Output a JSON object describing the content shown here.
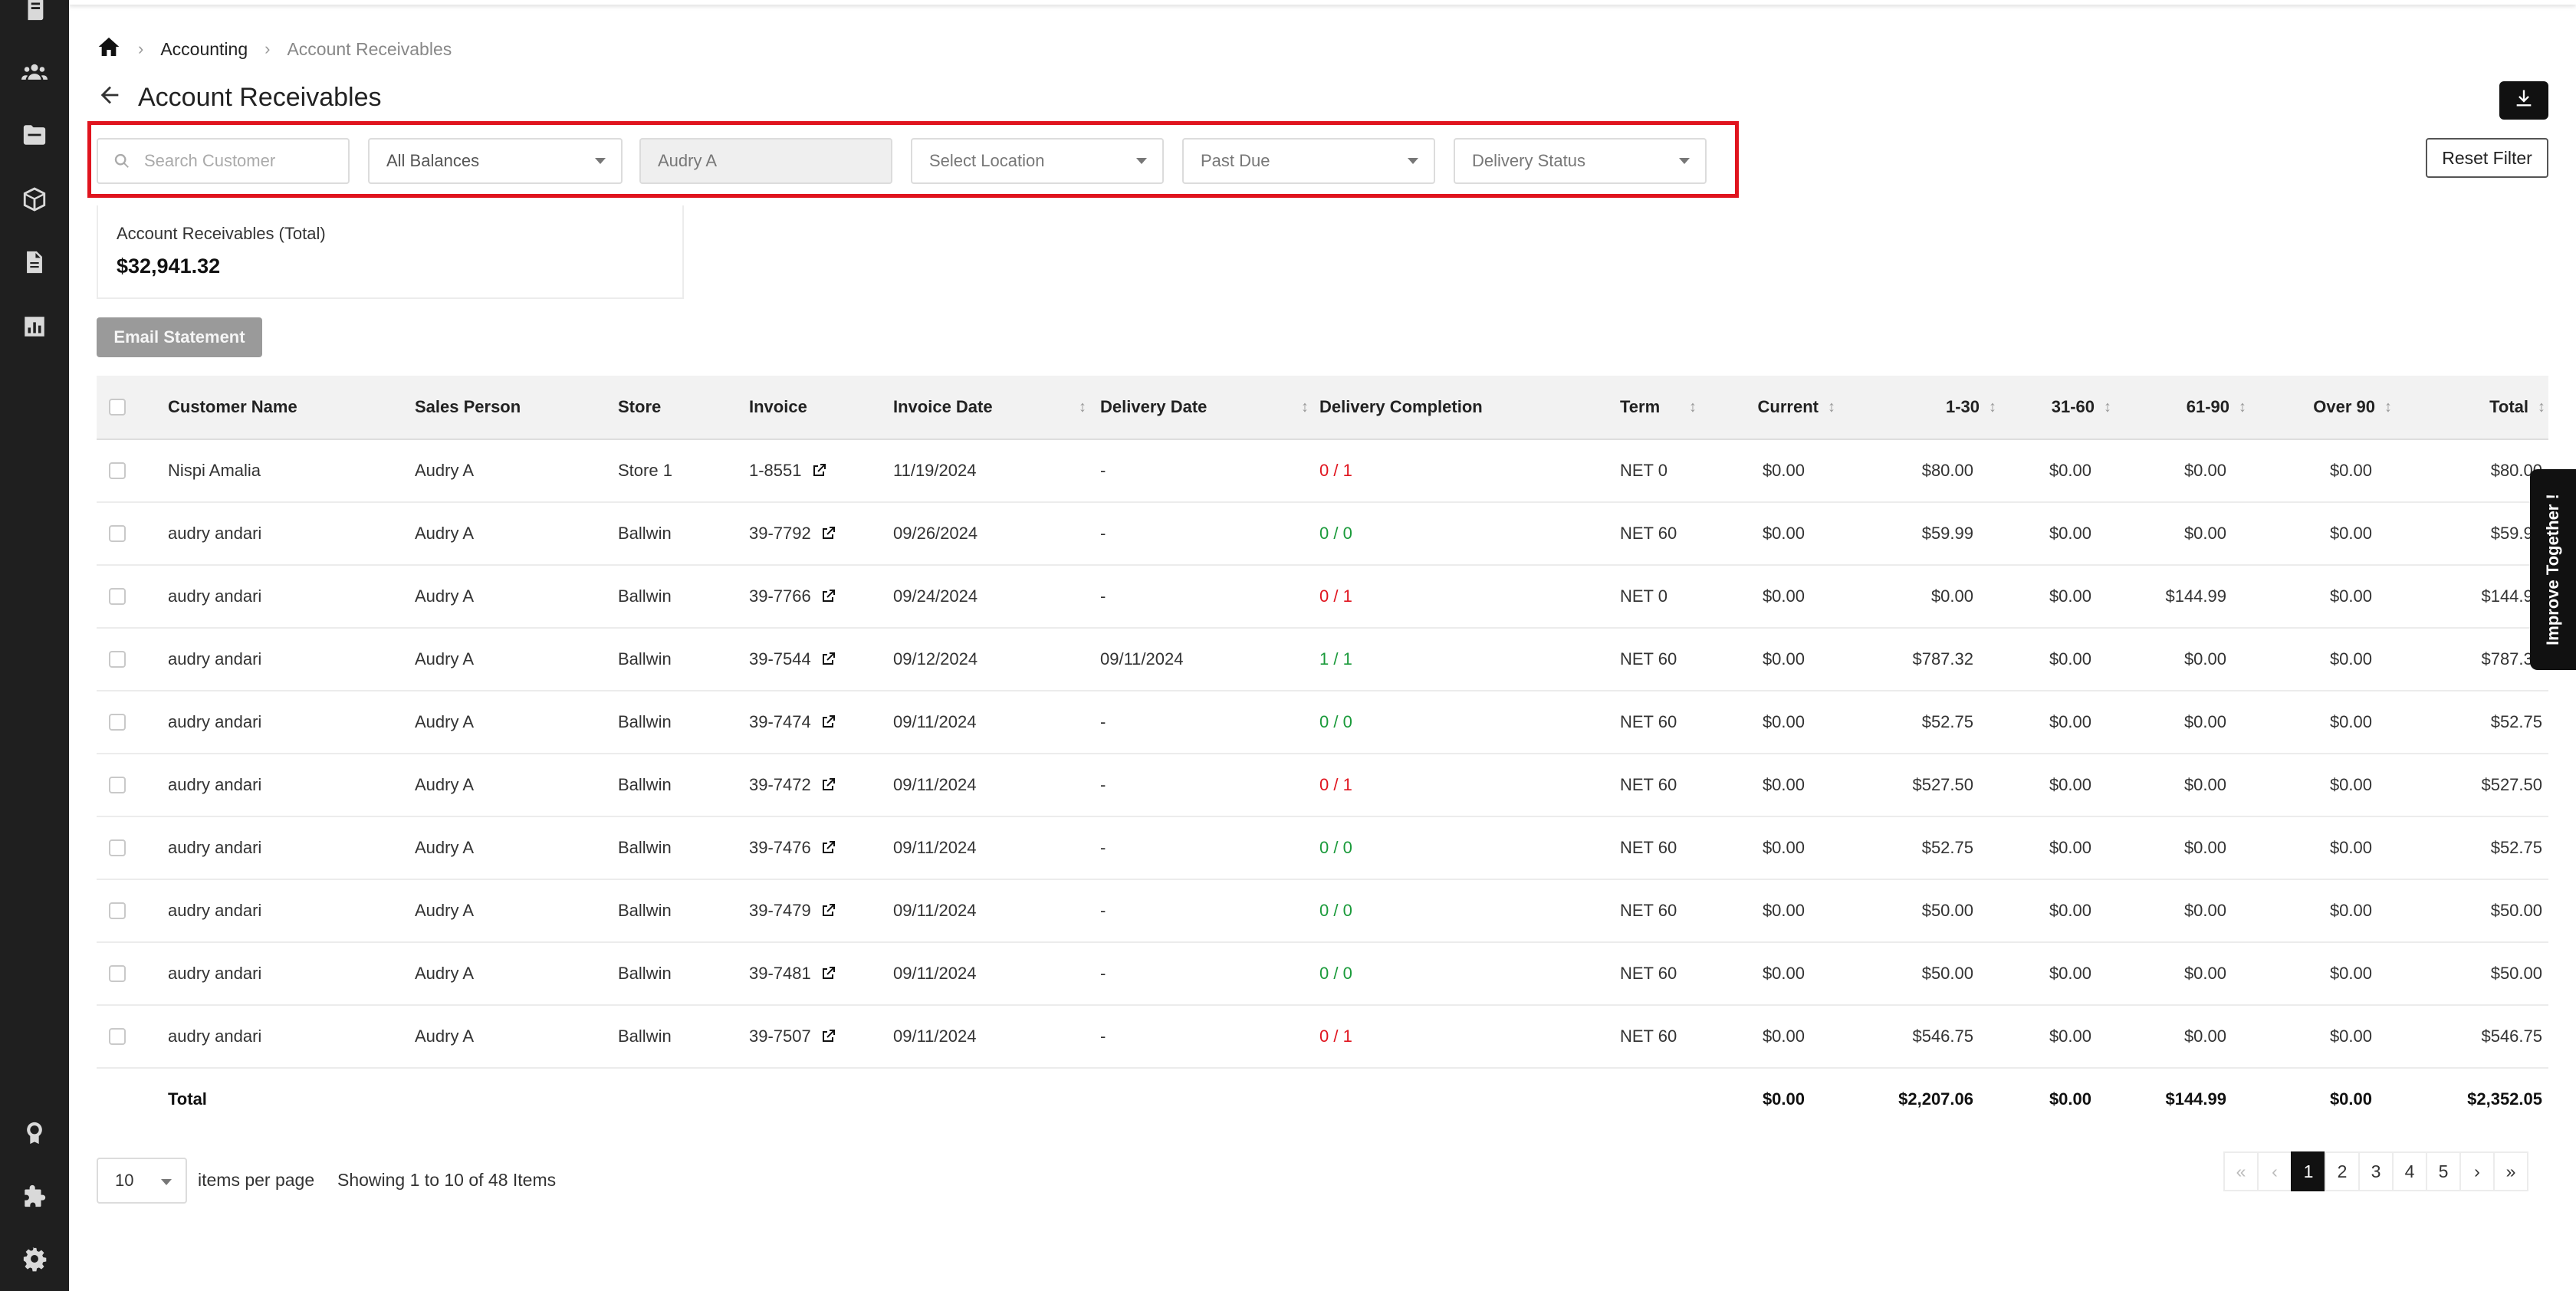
{
  "breadcrumb": {
    "parent": "Accounting",
    "current": "Account Receivables",
    "separator": "›"
  },
  "page": {
    "title": "Account Receivables"
  },
  "filters": {
    "search_placeholder": "Search Customer",
    "balances": "All Balances",
    "sales_person": "Audry A",
    "location": "Select Location",
    "past_due": "Past Due",
    "delivery_status": "Delivery Status",
    "reset_label": "Reset Filter"
  },
  "summary": {
    "label": "Account Receivables (Total)",
    "value": "$32,941.32"
  },
  "actions": {
    "email_statement": "Email Statement"
  },
  "table": {
    "headers": {
      "customer": "Customer Name",
      "sales_person": "Sales Person",
      "store": "Store",
      "invoice": "Invoice",
      "invoice_date": "Invoice Date",
      "delivery_date": "Delivery Date",
      "delivery_completion": "Delivery Completion",
      "term": "Term",
      "current": "Current",
      "d1_30": "1-30",
      "d31_60": "31-60",
      "d61_90": "61-90",
      "over90": "Over 90",
      "total": "Total"
    },
    "sort_glyph": "↕",
    "rows": [
      {
        "customer": "Nispi Amalia",
        "sales_person": "Audry A",
        "store": "Store 1",
        "invoice": "1-8551",
        "invoice_date": "11/19/2024",
        "delivery_date": "-",
        "delivery_completion": "0 / 1",
        "completion_status": "incomplete",
        "term": "NET 0",
        "current": "$0.00",
        "d1_30": "$80.00",
        "d31_60": "$0.00",
        "d61_90": "$0.00",
        "over90": "$0.00",
        "total": "$80.00"
      },
      {
        "customer": "audry andari",
        "sales_person": "Audry A",
        "store": "Ballwin",
        "invoice": "39-7792",
        "invoice_date": "09/26/2024",
        "delivery_date": "-",
        "delivery_completion": "0 / 0",
        "completion_status": "complete",
        "term": "NET 60",
        "current": "$0.00",
        "d1_30": "$59.99",
        "d31_60": "$0.00",
        "d61_90": "$0.00",
        "over90": "$0.00",
        "total": "$59.99"
      },
      {
        "customer": "audry andari",
        "sales_person": "Audry A",
        "store": "Ballwin",
        "invoice": "39-7766",
        "invoice_date": "09/24/2024",
        "delivery_date": "-",
        "delivery_completion": "0 / 1",
        "completion_status": "incomplete",
        "term": "NET 0",
        "current": "$0.00",
        "d1_30": "$0.00",
        "d31_60": "$0.00",
        "d61_90": "$144.99",
        "over90": "$0.00",
        "total": "$144.99"
      },
      {
        "customer": "audry andari",
        "sales_person": "Audry A",
        "store": "Ballwin",
        "invoice": "39-7544",
        "invoice_date": "09/12/2024",
        "delivery_date": "09/11/2024",
        "delivery_completion": "1 / 1",
        "completion_status": "complete",
        "term": "NET 60",
        "current": "$0.00",
        "d1_30": "$787.32",
        "d31_60": "$0.00",
        "d61_90": "$0.00",
        "over90": "$0.00",
        "total": "$787.32"
      },
      {
        "customer": "audry andari",
        "sales_person": "Audry A",
        "store": "Ballwin",
        "invoice": "39-7474",
        "invoice_date": "09/11/2024",
        "delivery_date": "-",
        "delivery_completion": "0 / 0",
        "completion_status": "complete",
        "term": "NET 60",
        "current": "$0.00",
        "d1_30": "$52.75",
        "d31_60": "$0.00",
        "d61_90": "$0.00",
        "over90": "$0.00",
        "total": "$52.75"
      },
      {
        "customer": "audry andari",
        "sales_person": "Audry A",
        "store": "Ballwin",
        "invoice": "39-7472",
        "invoice_date": "09/11/2024",
        "delivery_date": "-",
        "delivery_completion": "0 / 1",
        "completion_status": "incomplete",
        "term": "NET 60",
        "current": "$0.00",
        "d1_30": "$527.50",
        "d31_60": "$0.00",
        "d61_90": "$0.00",
        "over90": "$0.00",
        "total": "$527.50"
      },
      {
        "customer": "audry andari",
        "sales_person": "Audry A",
        "store": "Ballwin",
        "invoice": "39-7476",
        "invoice_date": "09/11/2024",
        "delivery_date": "-",
        "delivery_completion": "0 / 0",
        "completion_status": "complete",
        "term": "NET 60",
        "current": "$0.00",
        "d1_30": "$52.75",
        "d31_60": "$0.00",
        "d61_90": "$0.00",
        "over90": "$0.00",
        "total": "$52.75"
      },
      {
        "customer": "audry andari",
        "sales_person": "Audry A",
        "store": "Ballwin",
        "invoice": "39-7479",
        "invoice_date": "09/11/2024",
        "delivery_date": "-",
        "delivery_completion": "0 / 0",
        "completion_status": "complete",
        "term": "NET 60",
        "current": "$0.00",
        "d1_30": "$50.00",
        "d31_60": "$0.00",
        "d61_90": "$0.00",
        "over90": "$0.00",
        "total": "$50.00"
      },
      {
        "customer": "audry andari",
        "sales_person": "Audry A",
        "store": "Ballwin",
        "invoice": "39-7481",
        "invoice_date": "09/11/2024",
        "delivery_date": "-",
        "delivery_completion": "0 / 0",
        "completion_status": "complete",
        "term": "NET 60",
        "current": "$0.00",
        "d1_30": "$50.00",
        "d31_60": "$0.00",
        "d61_90": "$0.00",
        "over90": "$0.00",
        "total": "$50.00"
      },
      {
        "customer": "audry andari",
        "sales_person": "Audry A",
        "store": "Ballwin",
        "invoice": "39-7507",
        "invoice_date": "09/11/2024",
        "delivery_date": "-",
        "delivery_completion": "0 / 1",
        "completion_status": "incomplete",
        "term": "NET 60",
        "current": "$0.00",
        "d1_30": "$546.75",
        "d31_60": "$0.00",
        "d61_90": "$0.00",
        "over90": "$0.00",
        "total": "$546.75"
      }
    ],
    "totals": {
      "label": "Total",
      "current": "$0.00",
      "d1_30": "$2,207.06",
      "d31_60": "$0.00",
      "d61_90": "$144.99",
      "over90": "$0.00",
      "total": "$2,352.05"
    }
  },
  "feedback_tab": "Improve Together !",
  "pagination": {
    "per_page": "10",
    "per_page_label": "items per page",
    "showing": "Showing 1 to 10 of 48 Items",
    "first": "«",
    "prev": "‹",
    "next": "›",
    "last": "»",
    "pages": [
      "1",
      "2",
      "3",
      "4",
      "5"
    ],
    "current_page": "1"
  },
  "colors": {
    "incomplete": "#e0141e",
    "complete": "#1a9a3a",
    "highlight": "#e0141e"
  },
  "icons": {
    "sidebar": [
      "book-icon",
      "users-icon",
      "folder-icon",
      "box-icon",
      "document-icon",
      "chart-icon",
      "badge-icon",
      "puzzle-icon",
      "gear-icon"
    ]
  }
}
